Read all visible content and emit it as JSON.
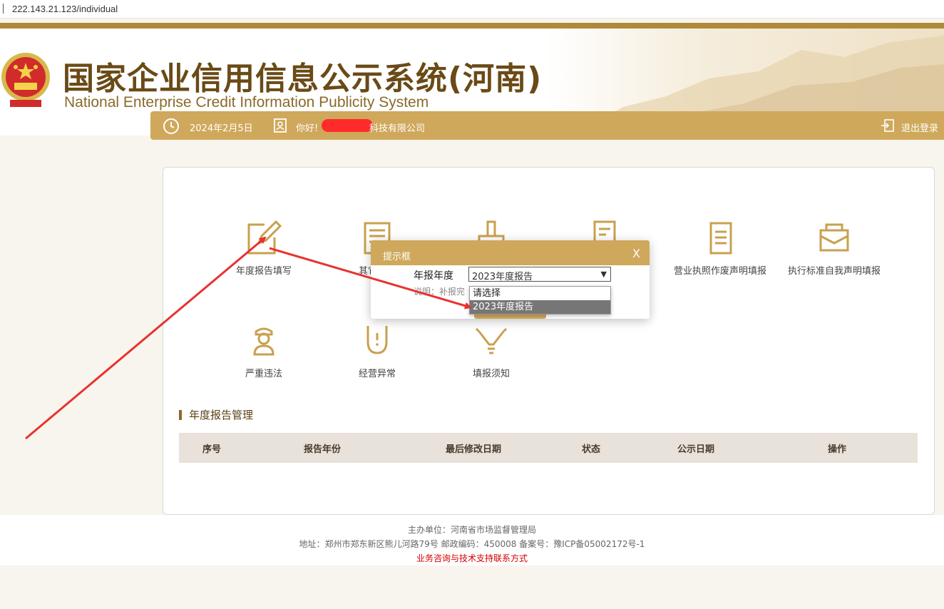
{
  "browser": {
    "url": "222.143.21.123/individual"
  },
  "header": {
    "title": "国家企业信用信息公示系统(河南)",
    "subtitle": "National Enterprise Credit Information Publicity System"
  },
  "userbar": {
    "date": "2024年2月5日",
    "greeting": "你好!",
    "company_suffix": "科技有限公司",
    "logout": "退出登录"
  },
  "tiles": [
    {
      "label": "年度报告填写",
      "icon": "pencil-edit-icon"
    },
    {
      "label": "其它自行",
      "icon": "newspaper-icon"
    },
    {
      "label": "",
      "icon": "stamp-icon"
    },
    {
      "label": "",
      "icon": "document-search-icon"
    },
    {
      "label": "营业执照作废声明填报",
      "icon": "document-icon"
    },
    {
      "label": "执行标准自我声明填报",
      "icon": "envelope-icon"
    },
    {
      "label": "严重违法",
      "icon": "officer-icon"
    },
    {
      "label": "经营异常",
      "icon": "magnet-icon"
    },
    {
      "label": "填报须知",
      "icon": "lightbulb-icon"
    }
  ],
  "section": {
    "title": "年度报告管理"
  },
  "table": {
    "headers": [
      "序号",
      "报告年份",
      "最后修改日期",
      "状态",
      "公示日期",
      "操作"
    ]
  },
  "modal": {
    "title": "提示框",
    "close": "X",
    "year_label": "年报年度",
    "selected": "2023年度报告",
    "note": "说明：补报完",
    "options": [
      "请选择",
      "2023年度报告"
    ],
    "highlighted_option": "2023年度报告"
  },
  "footer": {
    "sponsor": "主办单位：河南省市场监督管理局",
    "address": "地址：郑州市郑东新区熊儿河路79号 邮政编码：450008 备案号：豫ICP备05002172号-1",
    "contact": "业务咨询与技术支持联系方式"
  },
  "colors": {
    "gold": "#cfa85b",
    "brown": "#6a4a16",
    "annotation_red": "#e8322f"
  }
}
